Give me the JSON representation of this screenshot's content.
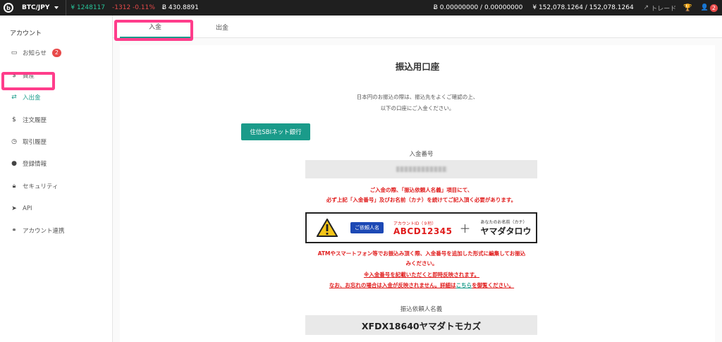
{
  "topbar": {
    "logo": "b",
    "pair": "BTC/JPY",
    "last_price": "¥ 1248117",
    "change": "-1312 -0.11%",
    "btc_value": "Ƀ 430.8891",
    "btc_balance": "Ƀ 0.00000000 / 0.00000000",
    "jpy_balance": "¥ 152,078.1264 / 152,078.1264",
    "trade_label": "トレード",
    "notifications_count": "2",
    "icons": [
      "chevron-down-icon",
      "trending-up-icon",
      "trophy-icon",
      "user-icon"
    ]
  },
  "sidebar": {
    "title": "アカウント",
    "items": [
      {
        "label": "お知らせ",
        "icon": "inbox-icon",
        "badge": "2"
      },
      {
        "label": "資産",
        "icon": "dollar-icon"
      },
      {
        "label": "入出金",
        "icon": "transfer-icon",
        "active": true
      },
      {
        "label": "注文履歴",
        "icon": "dollar-icon"
      },
      {
        "label": "取引履歴",
        "icon": "clock-icon"
      },
      {
        "label": "登録情報",
        "icon": "user-icon"
      },
      {
        "label": "セキュリティ",
        "icon": "lock-icon"
      },
      {
        "label": "API",
        "icon": "send-icon"
      },
      {
        "label": "アカウント連携",
        "icon": "link-icon"
      }
    ]
  },
  "tabs": {
    "deposit": "入金",
    "withdraw": "出金"
  },
  "main": {
    "title": "振込用口座",
    "intro_line1": "日本円のお振込の際は、振込先をよくご確認の上、",
    "intro_line2": "以下の口座にご入金ください。",
    "bank_button": "住信SBIネット銀行",
    "deposit_number_label": "入金番号",
    "notice_line1": "ご入金の際、「振込依頼人名義」項目にて、",
    "notice_line2": "必ず上記「入金番号」及びお名前（カナ）を続けてご記入頂く必要があります。",
    "instruction": {
      "requester_label": "ご依頼人名",
      "account_id_caption": "アカウントID（９桁）",
      "account_id": "ABCD12345",
      "plus": "＋",
      "name_caption": "あなたのお名前（カナ）",
      "name": "ヤマダタロウ"
    },
    "atm_line1": "ATMやスマートフォン等でお振込み頂く際、入金番号を追加した形式に編集してお振込",
    "atm_line2": "みください。",
    "reflect_line": "※入金番号を記載いただくと即時反映されます。",
    "forgot_prefix": "なお、お忘れの場合は入金が反映されません。詳細は",
    "forgot_link": "こちら",
    "forgot_suffix": "を御覧ください。",
    "requester_name_label": "振込依頼人名義",
    "requester_name": "XFDX18640ヤマダトモカズ"
  }
}
